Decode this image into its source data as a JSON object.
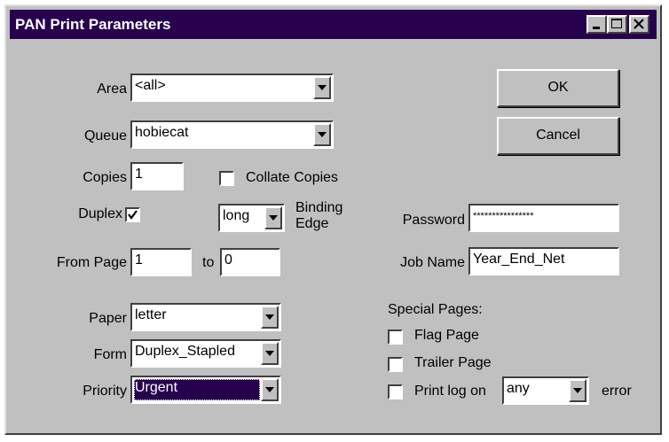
{
  "window": {
    "title": "PAN Print Parameters"
  },
  "titlebar_buttons": {
    "minimize": "minimize-icon",
    "maximize": "maximize-icon",
    "close": "close-icon"
  },
  "area": {
    "label": "Area",
    "value": "<all>"
  },
  "queue": {
    "label": "Queue",
    "value": "hobiecat"
  },
  "copies": {
    "label": "Copies",
    "value": "1"
  },
  "collate": {
    "label": "Collate Copies",
    "checked": false
  },
  "duplex": {
    "label": "Duplex",
    "checked": true
  },
  "binding_edge": {
    "label_line1": "Binding",
    "label_line2": "Edge",
    "value": "long"
  },
  "from_page": {
    "label": "From Page",
    "value": "1"
  },
  "to_page": {
    "label": "to",
    "value": "0"
  },
  "password": {
    "label": "Password",
    "value": "****************"
  },
  "job_name": {
    "label": "Job Name",
    "value": "Year_End_Net"
  },
  "paper": {
    "label": "Paper",
    "value": "letter"
  },
  "form": {
    "label": "Form",
    "value": "Duplex_Stapled"
  },
  "priority": {
    "label": "Priority",
    "value": "Urgent"
  },
  "special_pages": {
    "heading": "Special Pages:",
    "flag_page": {
      "label": "Flag Page",
      "checked": false
    },
    "trailer_page": {
      "label": "Trailer Page",
      "checked": false
    },
    "print_log": {
      "label": "Print log on",
      "value": "any",
      "suffix": "error",
      "checked": false
    }
  },
  "buttons": {
    "ok": "OK",
    "cancel": "Cancel"
  },
  "colors": {
    "titlebar": "#27004e",
    "face": "#c0c0c0",
    "selection": "#27004e"
  }
}
